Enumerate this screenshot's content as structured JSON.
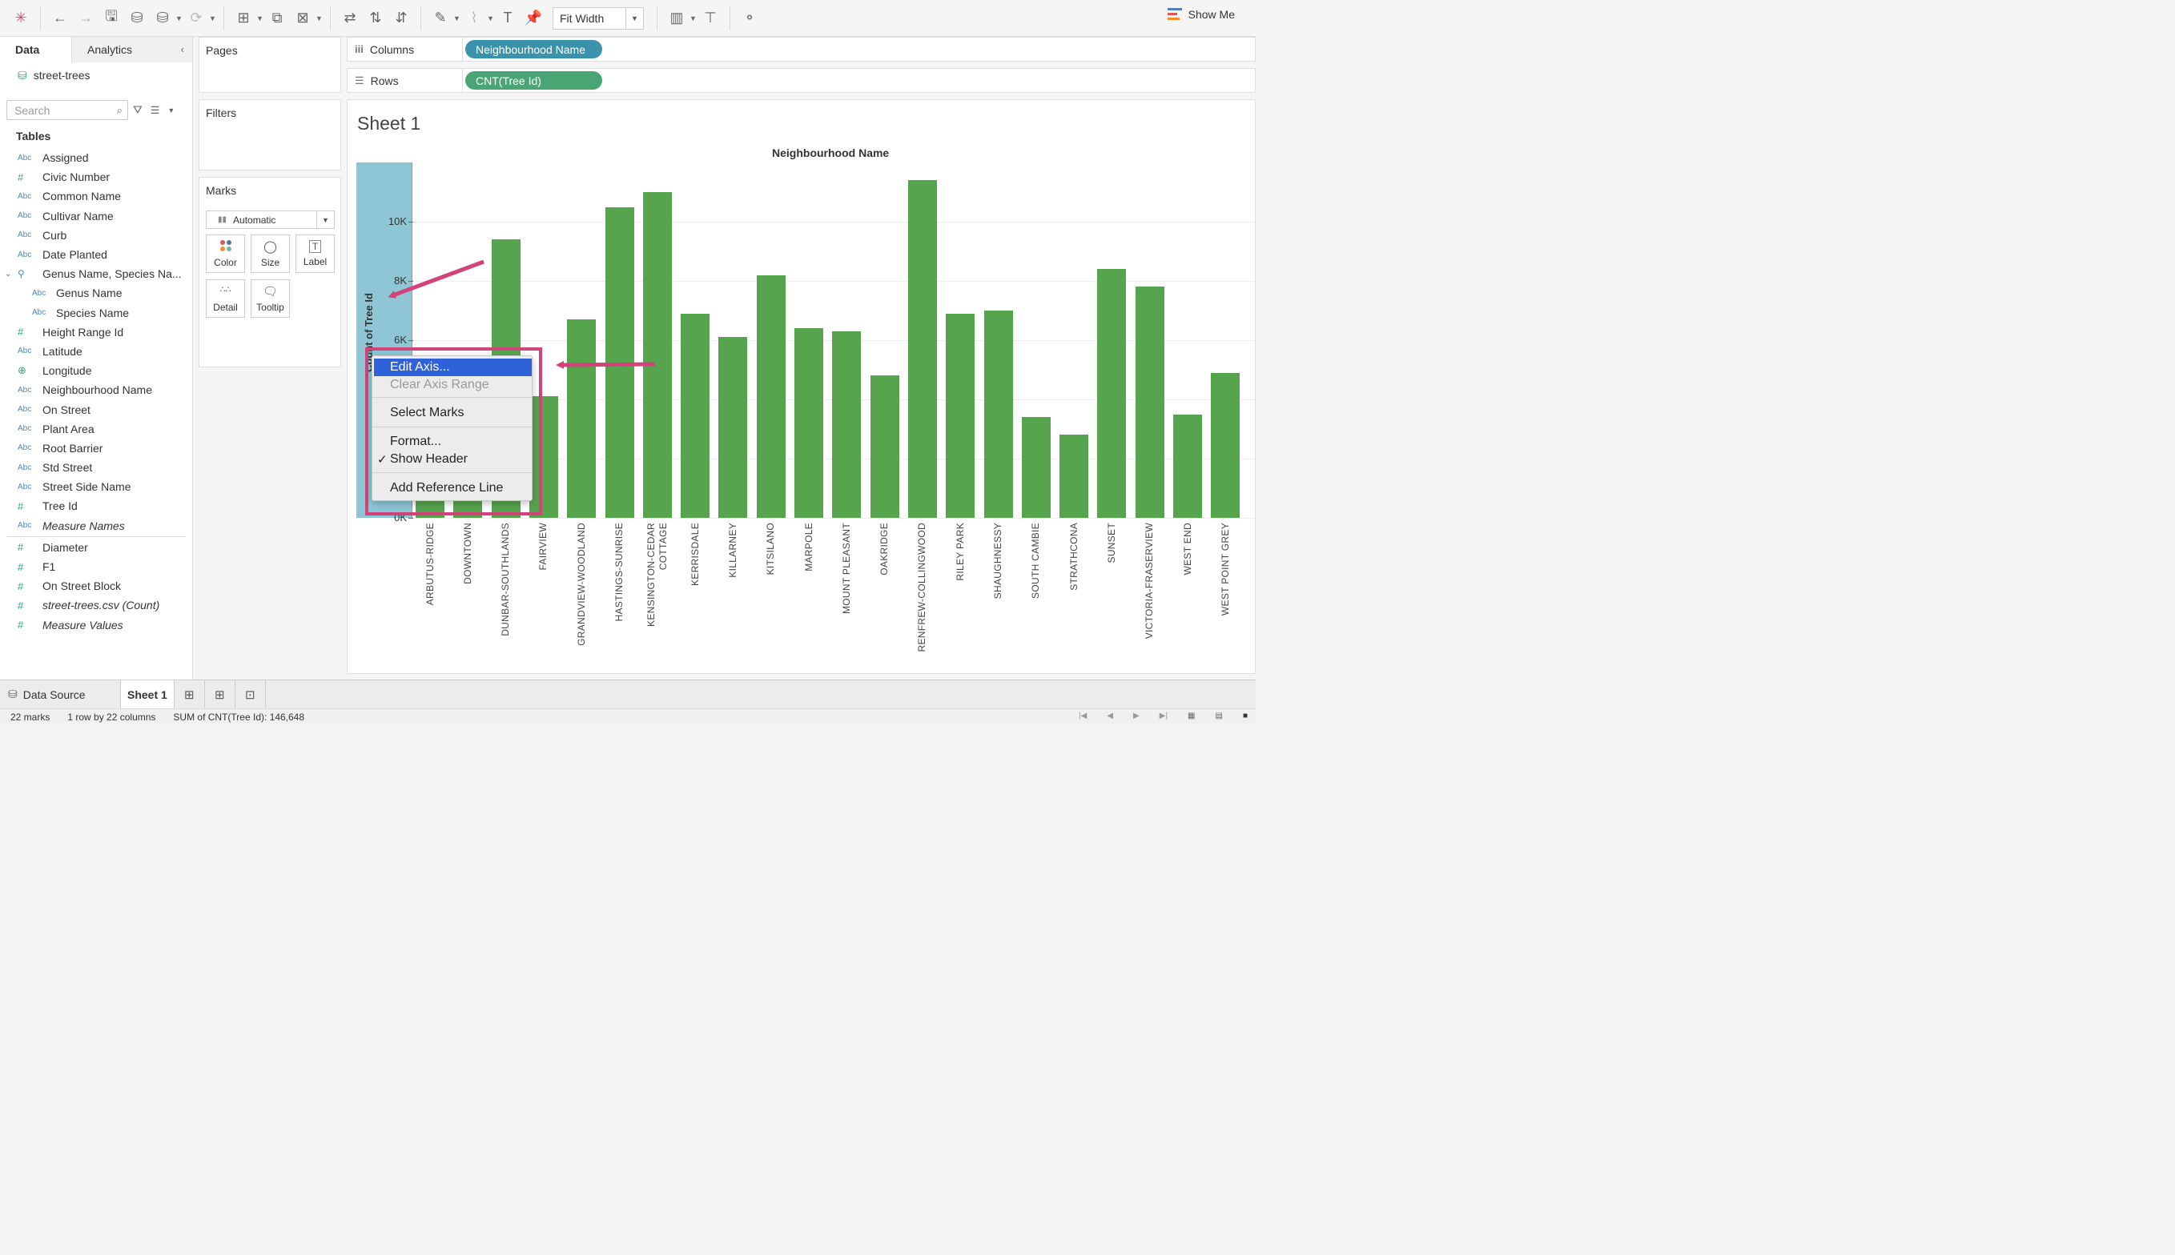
{
  "toolbar": {
    "fit_label": "Fit Width",
    "show_me_label": "Show Me"
  },
  "data_pane": {
    "tab_data": "Data",
    "tab_analytics": "Analytics",
    "datasource": "street-trees",
    "search_placeholder": "Search",
    "tables_heading": "Tables",
    "fields": [
      {
        "type": "Abc",
        "name": "Assigned"
      },
      {
        "type": "#",
        "name": "Civic Number"
      },
      {
        "type": "Abc",
        "name": "Common Name"
      },
      {
        "type": "Abc",
        "name": "Cultivar Name"
      },
      {
        "type": "Abc",
        "name": "Curb"
      },
      {
        "type": "Abc",
        "name": "Date Planted"
      },
      {
        "type": "hier",
        "name": "Genus Name, Species Na..."
      },
      {
        "type": "Abc",
        "name": "Genus Name"
      },
      {
        "type": "Abc",
        "name": "Species Name"
      },
      {
        "type": "#",
        "name": "Height Range Id"
      },
      {
        "type": "Abc",
        "name": "Latitude"
      },
      {
        "type": "geo",
        "name": "Longitude"
      },
      {
        "type": "Abc",
        "name": "Neighbourhood Name"
      },
      {
        "type": "Abc",
        "name": "On Street"
      },
      {
        "type": "Abc",
        "name": "Plant Area"
      },
      {
        "type": "Abc",
        "name": "Root Barrier"
      },
      {
        "type": "Abc",
        "name": "Std Street"
      },
      {
        "type": "Abc",
        "name": "Street Side Name"
      },
      {
        "type": "#",
        "name": "Tree Id"
      },
      {
        "type": "Abc",
        "name": "Measure Names"
      },
      {
        "type": "#",
        "name": "Diameter"
      },
      {
        "type": "#",
        "name": "F1"
      },
      {
        "type": "#",
        "name": "On Street Block"
      },
      {
        "type": "#",
        "name": "street-trees.csv (Count)"
      },
      {
        "type": "#",
        "name": "Measure Values"
      }
    ]
  },
  "shelves": {
    "pages": "Pages",
    "filters": "Filters",
    "marks": "Marks",
    "mark_type": "Automatic",
    "mark_buttons": [
      "Color",
      "Size",
      "Label",
      "Detail",
      "Tooltip"
    ],
    "columns_label": "Columns",
    "columns_pill": "Neighbourhood Name",
    "rows_label": "Rows",
    "rows_pill": "CNT(Tree Id)"
  },
  "sheet": {
    "title": "Sheet 1",
    "column_header": "Neighbourhood Name",
    "axis_title": "Count of Tree Id",
    "ticks": [
      "0K",
      "2K",
      "4K",
      "6K",
      "8K",
      "10K"
    ]
  },
  "chart_data": {
    "type": "bar",
    "title": "Sheet 1",
    "xlabel": "Neighbourhood Name",
    "ylabel": "Count of Tree Id",
    "ylim": [
      0,
      12000
    ],
    "categories": [
      "ARBUTUS-RIDGE",
      "DOWNTOWN",
      "DUNBAR-SOUTHLANDS",
      "FAIRVIEW",
      "GRANDVIEW-WOODLAND",
      "HASTINGS-SUNRISE",
      "KENSINGTON-CEDAR COTTAGE",
      "KERRISDALE",
      "KILLARNEY",
      "KITSILANO",
      "MARPOLE",
      "MOUNT PLEASANT",
      "OAKRIDGE",
      "RENFREW-COLLINGWOOD",
      "RILEY PARK",
      "SHAUGHNESSY",
      "SOUTH CAMBIE",
      "STRATHCONA",
      "SUNSET",
      "VICTORIA-FRASERVIEW",
      "WEST END",
      "WEST POINT GREY"
    ],
    "values": [
      5200,
      5500,
      9400,
      4100,
      6700,
      10500,
      11000,
      6900,
      6100,
      8200,
      6400,
      6300,
      4800,
      11400,
      6900,
      7000,
      3400,
      2800,
      8400,
      7800,
      3500,
      4900
    ],
    "grid": true
  },
  "context_menu": {
    "items": [
      "Edit Axis...",
      "Clear Axis Range",
      "Select Marks",
      "Format...",
      "Show Header",
      "Add Reference Line"
    ]
  },
  "tabs": {
    "data_source": "Data Source",
    "sheet1": "Sheet 1"
  },
  "status": {
    "marks": "22 marks",
    "dims": "1 row by 22 columns",
    "sum": "SUM of CNT(Tree Id): 146,648"
  },
  "colors": {
    "bar": "#57a44f",
    "axis_band": "#8ec6d6",
    "highlight": "#d2437a",
    "menu_selection": "#2f62d9"
  }
}
